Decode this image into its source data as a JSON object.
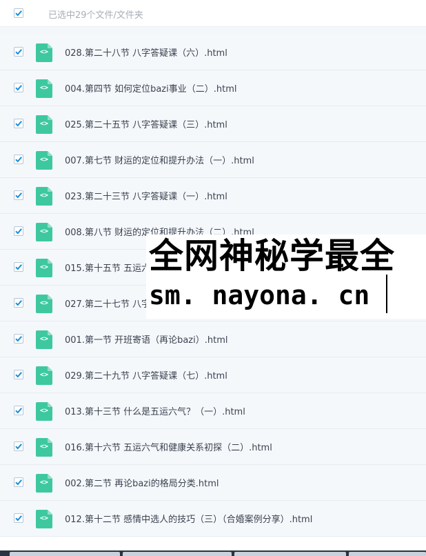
{
  "header": {
    "selected_text": "已选中29个文件/文件夹"
  },
  "files": [
    {
      "name": "028.第二十八节 八字答疑课（六）.html"
    },
    {
      "name": "004.第四节 如何定位bazi事业（二）.html"
    },
    {
      "name": "025.第二十五节 八字答疑课（三）.html"
    },
    {
      "name": "007.第七节 财运的定位和提升办法（一）.html"
    },
    {
      "name": "023.第二十三节 八字答疑课（一）.html"
    },
    {
      "name": "008.第八节 财运的定位和提升办法（二）.html"
    },
    {
      "name": "015.第十五节 五运六"
    },
    {
      "name": "027.第二十七节 八字"
    },
    {
      "name": "001.第一节 开班寄语（再论bazi）.html"
    },
    {
      "name": "029.第二十九节 八字答疑课（七）.html"
    },
    {
      "name": "013.第十三节 什么是五运六气？（一）.html"
    },
    {
      "name": "016.第十六节 五运六气和健康关系初探（二）.html"
    },
    {
      "name": "002.第二节 再论bazi的格局分类.html"
    },
    {
      "name": "012.第十二节 感情中选人的技巧（三）（合婚案例分享）.html"
    }
  ],
  "file_icon_glyph": "<>",
  "watermark": {
    "line1": "全网神秘学最全",
    "line2": "sm. nayona. cn"
  },
  "colors": {
    "accent": "#1a8fd8",
    "file_icon": "#3ec89f",
    "row_bg": "#f5f8fb"
  }
}
